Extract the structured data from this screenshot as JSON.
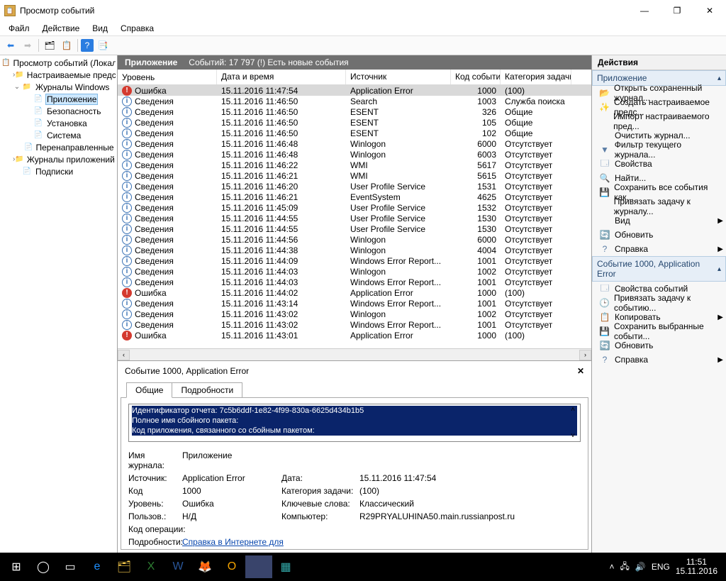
{
  "window": {
    "title": "Просмотр событий"
  },
  "menu": [
    "Файл",
    "Действие",
    "Вид",
    "Справка"
  ],
  "tree": [
    {
      "depth": 0,
      "toggle": "",
      "icon": "📋",
      "label": "Просмотр событий (Локальн",
      "selected": false
    },
    {
      "depth": 1,
      "toggle": "›",
      "icon": "📁",
      "label": "Настраиваемые представл...",
      "selected": false
    },
    {
      "depth": 1,
      "toggle": "⌄",
      "icon": "📁",
      "label": "Журналы Windows",
      "selected": false
    },
    {
      "depth": 2,
      "toggle": "",
      "icon": "📄",
      "label": "Приложение",
      "selected": true
    },
    {
      "depth": 2,
      "toggle": "",
      "icon": "📄",
      "label": "Безопасность",
      "selected": false
    },
    {
      "depth": 2,
      "toggle": "",
      "icon": "📄",
      "label": "Установка",
      "selected": false
    },
    {
      "depth": 2,
      "toggle": "",
      "icon": "📄",
      "label": "Система",
      "selected": false
    },
    {
      "depth": 2,
      "toggle": "",
      "icon": "📄",
      "label": "Перенаправленные соб",
      "selected": false
    },
    {
      "depth": 1,
      "toggle": "›",
      "icon": "📁",
      "label": "Журналы приложений и сл",
      "selected": false
    },
    {
      "depth": 1,
      "toggle": "",
      "icon": "📄",
      "label": "Подписки",
      "selected": false
    }
  ],
  "center": {
    "title": "Приложение",
    "subtitle": "Событий: 17 797 (!) Есть новые события",
    "columns": [
      "Уровень",
      "Дата и время",
      "Источник",
      "Код события",
      "Категория задачи"
    ]
  },
  "events": [
    {
      "level": "Ошибка",
      "date": "15.11.2016 11:47:54",
      "source": "Application Error",
      "id": 1000,
      "task": "(100)",
      "selected": true
    },
    {
      "level": "Сведения",
      "date": "15.11.2016 11:46:50",
      "source": "Search",
      "id": 1003,
      "task": "Служба поиска"
    },
    {
      "level": "Сведения",
      "date": "15.11.2016 11:46:50",
      "source": "ESENT",
      "id": 326,
      "task": "Общие"
    },
    {
      "level": "Сведения",
      "date": "15.11.2016 11:46:50",
      "source": "ESENT",
      "id": 105,
      "task": "Общие"
    },
    {
      "level": "Сведения",
      "date": "15.11.2016 11:46:50",
      "source": "ESENT",
      "id": 102,
      "task": "Общие"
    },
    {
      "level": "Сведения",
      "date": "15.11.2016 11:46:48",
      "source": "Winlogon",
      "id": 6000,
      "task": "Отсутствует"
    },
    {
      "level": "Сведения",
      "date": "15.11.2016 11:46:48",
      "source": "Winlogon",
      "id": 6003,
      "task": "Отсутствует"
    },
    {
      "level": "Сведения",
      "date": "15.11.2016 11:46:22",
      "source": "WMI",
      "id": 5617,
      "task": "Отсутствует"
    },
    {
      "level": "Сведения",
      "date": "15.11.2016 11:46:21",
      "source": "WMI",
      "id": 5615,
      "task": "Отсутствует"
    },
    {
      "level": "Сведения",
      "date": "15.11.2016 11:46:20",
      "source": "User Profile Service",
      "id": 1531,
      "task": "Отсутствует"
    },
    {
      "level": "Сведения",
      "date": "15.11.2016 11:46:21",
      "source": "EventSystem",
      "id": 4625,
      "task": "Отсутствует"
    },
    {
      "level": "Сведения",
      "date": "15.11.2016 11:45:09",
      "source": "User Profile Service",
      "id": 1532,
      "task": "Отсутствует"
    },
    {
      "level": "Сведения",
      "date": "15.11.2016 11:44:55",
      "source": "User Profile Service",
      "id": 1530,
      "task": "Отсутствует"
    },
    {
      "level": "Сведения",
      "date": "15.11.2016 11:44:55",
      "source": "User Profile Service",
      "id": 1530,
      "task": "Отсутствует"
    },
    {
      "level": "Сведения",
      "date": "15.11.2016 11:44:56",
      "source": "Winlogon",
      "id": 6000,
      "task": "Отсутствует"
    },
    {
      "level": "Сведения",
      "date": "15.11.2016 11:44:38",
      "source": "Winlogon",
      "id": 4004,
      "task": "Отсутствует"
    },
    {
      "level": "Сведения",
      "date": "15.11.2016 11:44:09",
      "source": "Windows Error Report...",
      "id": 1001,
      "task": "Отсутствует"
    },
    {
      "level": "Сведения",
      "date": "15.11.2016 11:44:03",
      "source": "Winlogon",
      "id": 1002,
      "task": "Отсутствует"
    },
    {
      "level": "Сведения",
      "date": "15.11.2016 11:44:03",
      "source": "Windows Error Report...",
      "id": 1001,
      "task": "Отсутствует"
    },
    {
      "level": "Ошибка",
      "date": "15.11.2016 11:44:02",
      "source": "Application Error",
      "id": 1000,
      "task": "(100)"
    },
    {
      "level": "Сведения",
      "date": "15.11.2016 11:43:14",
      "source": "Windows Error Report...",
      "id": 1001,
      "task": "Отсутствует"
    },
    {
      "level": "Сведения",
      "date": "15.11.2016 11:43:02",
      "source": "Winlogon",
      "id": 1002,
      "task": "Отсутствует"
    },
    {
      "level": "Сведения",
      "date": "15.11.2016 11:43:02",
      "source": "Windows Error Report...",
      "id": 1001,
      "task": "Отсутствует"
    },
    {
      "level": "Ошибка",
      "date": "15.11.2016 11:43:01",
      "source": "Application Error",
      "id": 1000,
      "task": "(100)"
    }
  ],
  "detail": {
    "title": "Событие 1000, Application Error",
    "tabs": [
      "Общие",
      "Подробности"
    ],
    "highlight": [
      "Идентификатор отчета: 7c5b6ddf-1e82-4f99-830a-6625d434b1b5",
      "Полное имя сбойного пакета:",
      "Код приложения, связанного со сбойным пакетом:"
    ],
    "fields": {
      "log_label": "Имя журнала:",
      "log_value": "Приложение",
      "source_label": "Источник:",
      "source_value": "Application Error",
      "date_label": "Дата:",
      "date_value": "15.11.2016 11:47:54",
      "code_label": "Код",
      "code_value": "1000",
      "task_label": "Категория задачи:",
      "task_value": "(100)",
      "level_label": "Уровень:",
      "level_value": "Ошибка",
      "keywords_label": "Ключевые слова:",
      "keywords_value": "Классический",
      "user_label": "Пользов.:",
      "user_value": "Н/Д",
      "computer_label": "Компьютер:",
      "computer_value": "R29PRYALUHINA50.main.russianpost.ru",
      "opcode_label": "Код операции:",
      "moreinfo_label": "Подробности:",
      "moreinfo_link": "Справка в Интернете для"
    }
  },
  "actions": {
    "title": "Действия",
    "section1": "Приложение",
    "items1": [
      {
        "icon": "📂",
        "label": "Открыть сохраненный журнал..."
      },
      {
        "icon": "✨",
        "label": "Создать настраиваемое предс..."
      },
      {
        "icon": "",
        "label": "Импорт настраиваемого пред..."
      },
      {
        "icon": "",
        "label": "Очистить журнал..."
      },
      {
        "icon": "▼",
        "label": "Фильтр текущего журнала..."
      },
      {
        "icon": "🗔",
        "label": "Свойства"
      },
      {
        "icon": "🔍",
        "label": "Найти..."
      },
      {
        "icon": "💾",
        "label": "Сохранить все события как..."
      },
      {
        "icon": "",
        "label": "Привязать задачу к журналу..."
      },
      {
        "icon": "",
        "label": "Вид",
        "arrow": true
      },
      {
        "icon": "🔄",
        "label": "Обновить"
      },
      {
        "icon": "?",
        "label": "Справка",
        "arrow": true
      }
    ],
    "section2": "Событие 1000, Application Error",
    "items2": [
      {
        "icon": "🗔",
        "label": "Свойства событий"
      },
      {
        "icon": "🕒",
        "label": "Привязать задачу к событию..."
      },
      {
        "icon": "📋",
        "label": "Копировать",
        "arrow": true
      },
      {
        "icon": "💾",
        "label": "Сохранить выбранные событи..."
      },
      {
        "icon": "🔄",
        "label": "Обновить"
      },
      {
        "icon": "?",
        "label": "Справка",
        "arrow": true
      }
    ]
  },
  "taskbar": {
    "lang": "ENG",
    "time": "11:51",
    "date": "15.11.2016"
  }
}
